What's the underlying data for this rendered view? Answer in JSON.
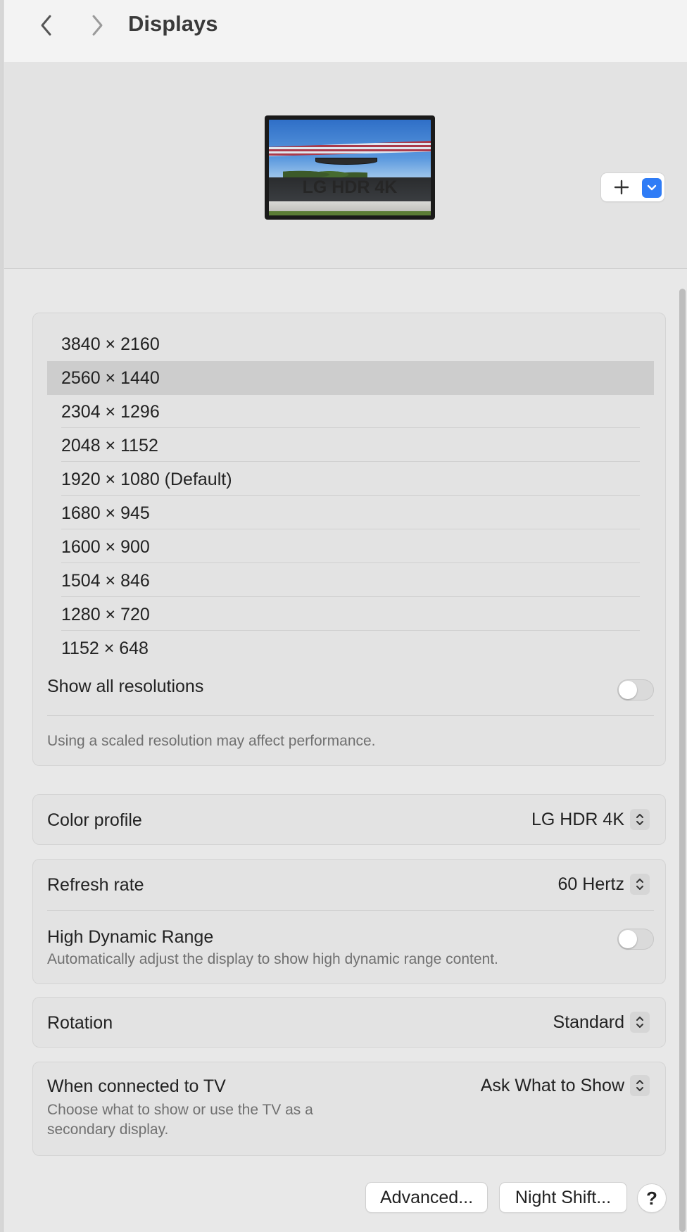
{
  "toolbar": {
    "title": "Displays",
    "back_icon": "chevron-left-icon",
    "forward_icon": "chevron-right-icon"
  },
  "display": {
    "name": "LG HDR 4K",
    "add_icon": "plus-icon",
    "menu_icon": "chevron-down-icon",
    "accent": "#2f7cf6"
  },
  "resolutions": {
    "items": [
      "3840 × 2160",
      "2560 × 1440",
      "2304 × 1296",
      "2048 × 1152",
      "1920 × 1080 (Default)",
      "1680 × 945",
      "1600 × 900",
      "1504 × 846",
      "1280 × 720",
      "1152 × 648"
    ],
    "selected": "2560 × 1440",
    "show_all_label": "Show all resolutions",
    "show_all_on": false,
    "note": "Using a scaled resolution may affect performance."
  },
  "color_profile": {
    "label": "Color profile",
    "value": "LG HDR 4K"
  },
  "refresh_rate": {
    "label": "Refresh rate",
    "value": "60 Hertz"
  },
  "hdr": {
    "label": "High Dynamic Range",
    "description": "Automatically adjust the display to show high dynamic range content.",
    "on": false
  },
  "rotation": {
    "label": "Rotation",
    "value": "Standard"
  },
  "tv": {
    "label": "When connected to TV",
    "description_line1": "Choose what to show or use the TV as a",
    "description_line2": "secondary display.",
    "value": "Ask What to Show"
  },
  "buttons": {
    "advanced": "Advanced...",
    "night_shift": "Night Shift...",
    "help": "?"
  }
}
